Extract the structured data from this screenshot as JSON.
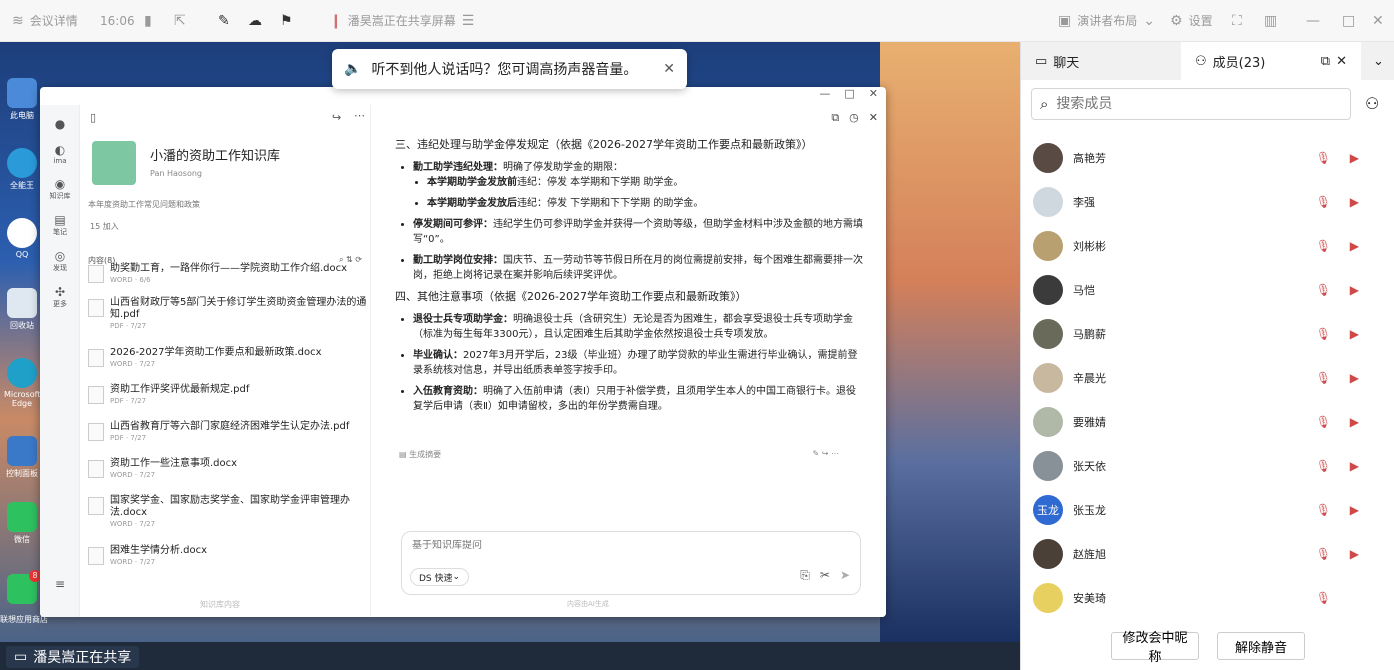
{
  "topbar": {
    "meeting_info": "会议详情",
    "time": "16:06",
    "sharing_status": "潘昊嵩正在共享屏幕",
    "presenter_layout": "演讲者布局",
    "settings": "设置"
  },
  "toast": {
    "message": "听不到他人说话吗？您可调高扬声器音量。"
  },
  "desktop": {
    "icons": [
      "此电脑",
      "全能王",
      "QQ",
      "回收站",
      "Microsoft Edge",
      "控制面板",
      "微信"
    ],
    "badge": "8",
    "taskbar_note": "联想应用商店",
    "share_label": "潘昊嵩正在共享"
  },
  "kb": {
    "title": "小潘的资助工作知识库",
    "author": "Pan Haosong",
    "desc": "本年度资助工作常见问题和政策",
    "count": "15 加入",
    "list_header": "内容(8)",
    "rail": [
      "ima",
      "知识库",
      "笔记",
      "发现",
      "更多"
    ],
    "docs": [
      {
        "name": "助奖勤工育，一路伴你行——学院资助工作介绍.docx",
        "meta": "WORD · 6/6"
      },
      {
        "name": "山西省财政厅等5部门关于修订学生资助资金管理办法的通知.pdf",
        "meta": "PDF · 7/27"
      },
      {
        "name": "2026-2027学年资助工作要点和最新政策.docx",
        "meta": "WORD · 7/27"
      },
      {
        "name": "资助工作评奖评优最新规定.pdf",
        "meta": "PDF · 7/27"
      },
      {
        "name": "山西省教育厅等六部门家庭经济困难学生认定办法.pdf",
        "meta": "PDF · 7/27"
      },
      {
        "name": "资助工作一些注意事项.docx",
        "meta": "WORD · 7/27"
      },
      {
        "name": "国家奖学金、国家励志奖学金、国家助学金评审管理办法.docx",
        "meta": "WORD · 7/27"
      },
      {
        "name": "困难生学情分析.docx",
        "meta": "WORD · 7/27"
      }
    ],
    "left_footer": "知识库内容"
  },
  "answer": {
    "h3": "三、违纪处理与助学金停发规定（依据《2026-2027学年资助工作要点和最新政策》）",
    "b1_title": "勤工助学违纪处理：",
    "b1_text": "明确了停发助学金的期限：",
    "b1a_title": "本学期助学金发放前",
    "b1a_text": "违纪：停发 本学期和下学期 助学金。",
    "b1b_title": "本学期助学金发放后",
    "b1b_text": "违纪：停发 下学期和下下学期 的助学金。",
    "b2_title": "停发期间可参评：",
    "b2_text": "违纪学生仍可参评助学金并获得一个资助等级，但助学金材料中涉及金额的地方需填写“0”。",
    "b3_title": "勤工助学岗位安排：",
    "b3_text": "国庆节、五一劳动节等节假日所在月的岗位需提前安排，每个困难生都需要排一次岗，拒绝上岗将记录在案并影响后续评奖评优。",
    "h4": "四、其他注意事项（依据《2026-2027学年资助工作要点和最新政策》）",
    "c1_title": "退役士兵专项助学金：",
    "c1_text": "明确退役士兵（含研究生）无论是否为困难生，都会享受退役士兵专项助学金（标准为每生每年3300元），且认定困难生后其助学金依然按退役士兵专项发放。",
    "c2_title": "毕业确认：",
    "c2_text": "2027年3月开学后，23级（毕业班）办理了助学贷款的毕业生需进行毕业确认，需提前登录系统核对信息，并导出纸质表单签字按手印。",
    "c3_title": "入伍教育资助：",
    "c3_text": "明确了入伍前申请（表Ⅰ）只用于补偿学费，且须用学生本人的中国工商银行卡。退役复学后申请（表Ⅱ）如申请留校，多出的年份学费需自理。",
    "gen_summary": "生成摘要",
    "ask_placeholder": "基于知识库提问",
    "mode": "DS 快速",
    "footer": "内容由AI生成"
  },
  "panel": {
    "tab_chat": "聊天",
    "tab_members": "成员(23)",
    "search_placeholder": "搜索成员",
    "members": [
      {
        "name": "高艳芳",
        "avatar": "",
        "color": "#5a4a44",
        "cam": true
      },
      {
        "name": "李强",
        "avatar": "",
        "color": "#cfd8de",
        "cam": true
      },
      {
        "name": "刘彬彬",
        "avatar": "",
        "color": "#b8a070",
        "cam": true
      },
      {
        "name": "马恺",
        "avatar": "",
        "color": "#3b3b3b",
        "cam": true
      },
      {
        "name": "马鹏薪",
        "avatar": "",
        "color": "#6a6a5a",
        "cam": true
      },
      {
        "name": "辛晨光",
        "avatar": "",
        "color": "#c9b8a0",
        "cam": true
      },
      {
        "name": "要雅婧",
        "avatar": "",
        "color": "#b0b8a8",
        "cam": true
      },
      {
        "name": "张天依",
        "avatar": "",
        "color": "#889098",
        "cam": true
      },
      {
        "name": "张玉龙",
        "avatar": "玉龙",
        "color": "#2e6ad1",
        "cam": true
      },
      {
        "name": "赵旌旭",
        "avatar": "",
        "color": "#4a4038",
        "cam": true
      },
      {
        "name": "安美琦",
        "avatar": "",
        "color": "#e8d060",
        "cam": false
      }
    ],
    "rename_btn": "修改会中昵称",
    "unmute_btn": "解除静音"
  },
  "colors": {
    "accent": "#2e6ad1",
    "muted_red": "#d04848"
  }
}
